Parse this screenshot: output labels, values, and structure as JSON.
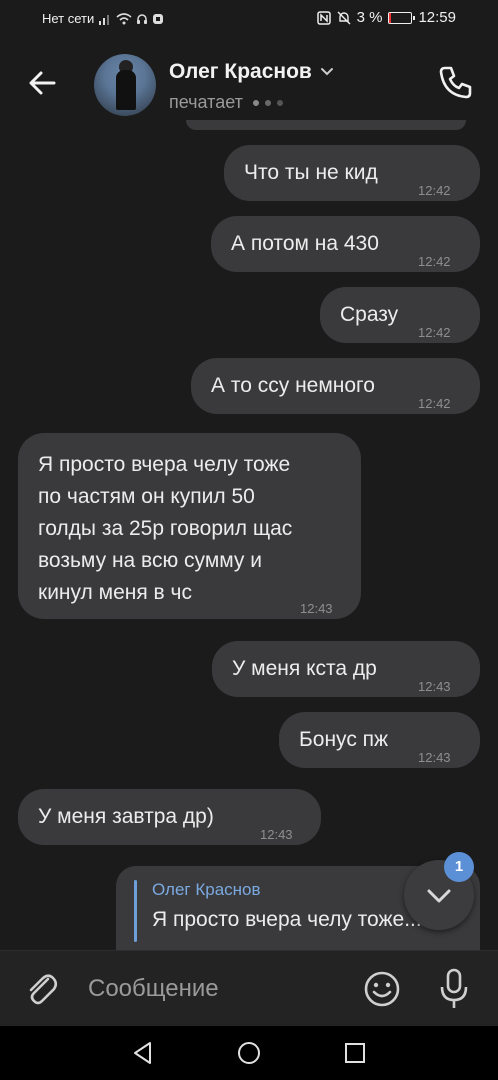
{
  "status_bar": {
    "carrier": "Нет сети",
    "battery_percent": "3 %",
    "battery_level": 0.03,
    "time": "12:59"
  },
  "header": {
    "contact_name": "Олег Краснов",
    "status": "печатает",
    "icons": {
      "back": "arrow-left",
      "call": "phone",
      "name_dropdown": "chevron-down"
    }
  },
  "messages": [
    {
      "direction": "outgoing",
      "lines": [
        "Что ты не кид"
      ],
      "time": "12:42"
    },
    {
      "direction": "outgoing",
      "lines": [
        "А потом на 430"
      ],
      "time": "12:42"
    },
    {
      "direction": "outgoing",
      "lines": [
        "Сразу"
      ],
      "time": "12:42"
    },
    {
      "direction": "outgoing",
      "lines": [
        "А то ссу немного"
      ],
      "time": "12:42"
    },
    {
      "direction": "incoming",
      "lines": [
        "Я просто вчера челу тоже",
        "по частям он купил 50",
        "голды за 25р говорил щас",
        "возьму на всю сумму и",
        "кинул меня в чс"
      ],
      "time": "12:43"
    },
    {
      "direction": "outgoing",
      "lines": [
        "У меня кста др"
      ],
      "time": "12:43"
    },
    {
      "direction": "outgoing",
      "lines": [
        "Бонус пж"
      ],
      "time": "12:43"
    },
    {
      "direction": "incoming",
      "lines": [
        "У меня завтра др)"
      ],
      "time": "12:43"
    }
  ],
  "reply_preview": {
    "author": "Олег Краснов",
    "text": "Я просто вчера челу тоже..."
  },
  "scroll_down": {
    "unread_count": "1",
    "icon": "chevron-down"
  },
  "composer": {
    "placeholder": "Сообщение",
    "icons": {
      "attach": "paperclip",
      "emoji": "smiley",
      "mic": "microphone"
    }
  },
  "navbar": {
    "icons": [
      "triangle-back",
      "circle-home",
      "square-recent"
    ]
  },
  "colors": {
    "background": "#1b1b1c",
    "bubble": "#3a3a3c",
    "accent": "#5b8fd6"
  }
}
